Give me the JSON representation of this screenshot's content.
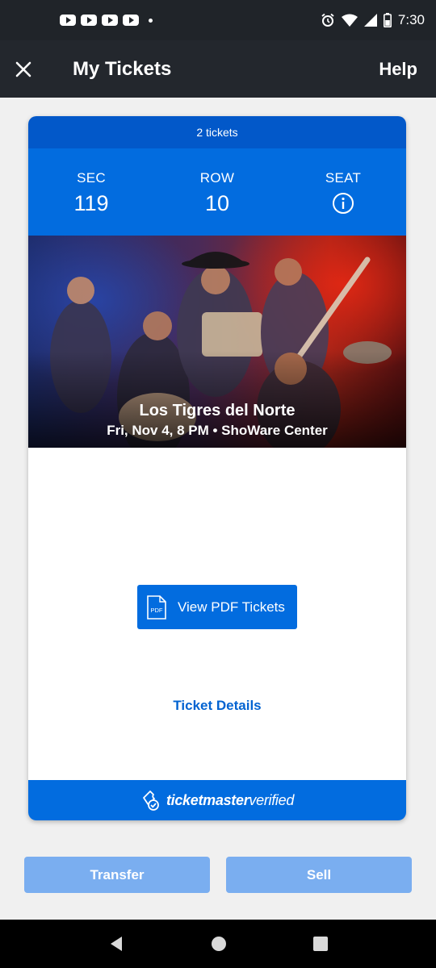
{
  "status_bar": {
    "time": "7:30",
    "notification_icons": [
      "youtube-icon",
      "youtube-icon",
      "youtube-icon",
      "youtube-icon",
      "more-dot-icon"
    ],
    "system_icons": [
      "alarm-icon",
      "wifi-icon",
      "signal-icon",
      "battery-icon"
    ]
  },
  "app_bar": {
    "title": "My Tickets",
    "help_label": "Help",
    "close_icon": "close-icon"
  },
  "ticket": {
    "count_label": "2 tickets",
    "sec_label": "SEC",
    "sec_value": "119",
    "row_label": "ROW",
    "row_value": "10",
    "seat_label": "SEAT",
    "seat_icon": "info-icon",
    "event_name": "Los Tigres del Norte",
    "event_meta": "Fri, Nov 4, 8 PM • ShoWare Center",
    "pdf_button_label": "View PDF Tickets",
    "pdf_icon_text": "PDF",
    "details_link": "Ticket Details",
    "verified_brand": "ticketmaster",
    "verified_suffix": "verified"
  },
  "actions": {
    "transfer_label": "Transfer",
    "sell_label": "Sell"
  },
  "colors": {
    "brand_blue": "#026cdf",
    "header_blue": "#0258c9",
    "disabled_blue": "#7aaef0",
    "app_bar": "#23272d"
  },
  "nav_bar": {
    "icons": [
      "back-icon",
      "home-icon",
      "recents-icon"
    ]
  }
}
